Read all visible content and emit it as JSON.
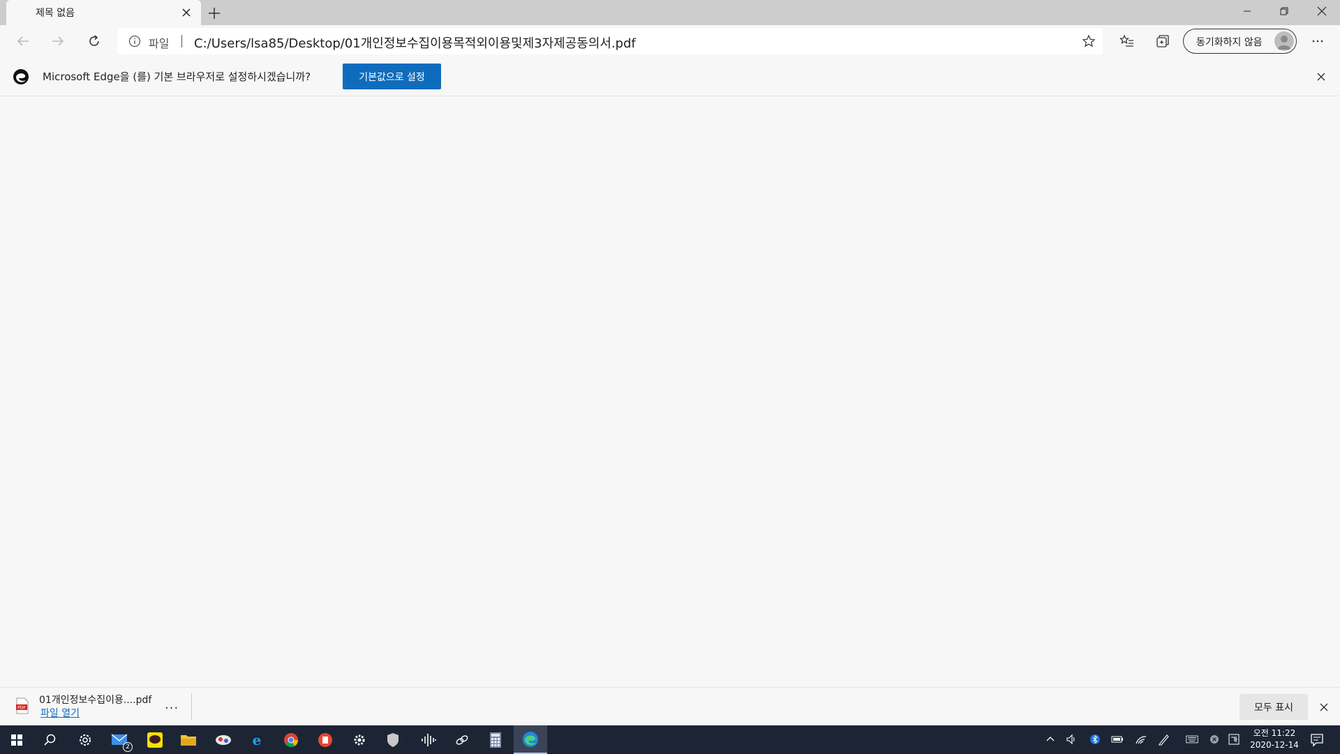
{
  "tab": {
    "title": "제목 없음"
  },
  "window_controls": {
    "minimize": "minimize-icon",
    "maximize": "restore-icon",
    "close": "close-icon"
  },
  "address_bar": {
    "scheme_label": "파일",
    "url": "C:/Users/lsa85/Desktop/01개인정보수집이용목적외이용및제3자제공동의서.pdf"
  },
  "profile": {
    "label": "동기화하지 않음"
  },
  "infobar": {
    "message": "Microsoft Edge을 (를) 기본 브라우저로 설정하시겠습니까?",
    "button_label": "기본값으로 설정"
  },
  "download": {
    "file_name": "01개인정보수집이용....pdf",
    "open_link": "파일 열기",
    "more": "...",
    "show_all_label": "모두 표시"
  },
  "taskbar": {
    "mail_badge": "2",
    "clock_time": "오전 11:22",
    "clock_date": "2020-12-14",
    "apps": [
      "start-icon",
      "search-icon",
      "settings-app-icon",
      "mail-icon",
      "kakaotalk-icon",
      "file-explorer-icon",
      "cloud-app-icon",
      "internet-explorer-icon",
      "chrome-icon",
      "red-app-icon",
      "gear-icon",
      "shield-icon",
      "audio-wave-icon",
      "link-icon",
      "calculator-icon",
      "edge-icon"
    ]
  },
  "colors": {
    "accent": "#0f6cbd",
    "taskbar": "#1d2535",
    "tabstrip": "#cdcdcd"
  }
}
